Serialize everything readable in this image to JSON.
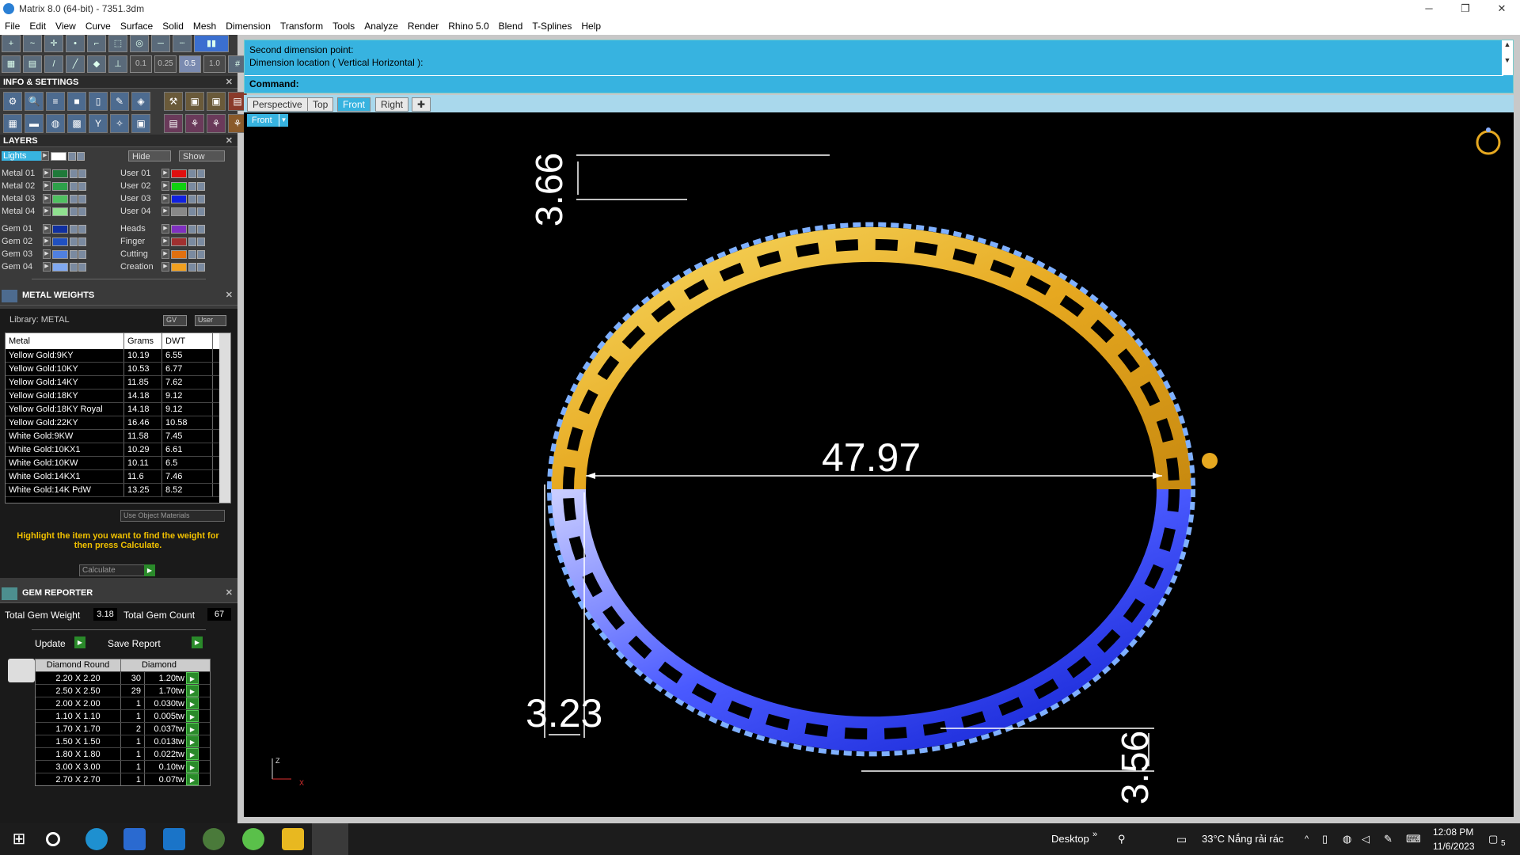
{
  "title": "Matrix 8.0 (64-bit) - 7351.3dm",
  "window_controls": [
    "─",
    "❐",
    "✕"
  ],
  "menu": [
    "File",
    "Edit",
    "View",
    "Curve",
    "Surface",
    "Solid",
    "Mesh",
    "Dimension",
    "Transform",
    "Tools",
    "Analyze",
    "Render",
    "Rhino 5.0",
    "Blend",
    "T-Splines",
    "Help"
  ],
  "toolbar_values": [
    "0.1",
    "0.25",
    "0.5",
    "1.0"
  ],
  "info_settings": {
    "title": "INFO & SETTINGS"
  },
  "layers": {
    "title": "LAYERS",
    "lights": "Lights",
    "hide": "Hide",
    "show": "Show",
    "left": [
      {
        "name": "Metal 01",
        "color": "#1f7a3a"
      },
      {
        "name": "Metal 02",
        "color": "#2ea04a"
      },
      {
        "name": "Metal 03",
        "color": "#4fc060"
      },
      {
        "name": "Metal 04",
        "color": "#8fe08f"
      },
      {
        "name": "Gem 01",
        "color": "#1030a0"
      },
      {
        "name": "Gem 02",
        "color": "#2050c0"
      },
      {
        "name": "Gem 03",
        "color": "#5080e0"
      },
      {
        "name": "Gem 04",
        "color": "#80a8f0"
      }
    ],
    "right": [
      {
        "name": "User 01",
        "color": "#e01010"
      },
      {
        "name": "User 02",
        "color": "#10d010"
      },
      {
        "name": "User 03",
        "color": "#1020e0"
      },
      {
        "name": "User 04",
        "color": "#888888"
      },
      {
        "name": "Heads",
        "color": "#8030c0"
      },
      {
        "name": "Finger",
        "color": "#a03030"
      },
      {
        "name": "Cutting",
        "color": "#e07010"
      },
      {
        "name": "Creation",
        "color": "#f0a020"
      }
    ]
  },
  "metal_weights": {
    "title": "METAL WEIGHTS",
    "library": "Library: METAL",
    "gv": "GV",
    "user": "User",
    "columns": [
      "Metal",
      "Grams",
      "DWT"
    ],
    "rows": [
      [
        "Yellow Gold:9KY",
        "10.19",
        "6.55"
      ],
      [
        "Yellow Gold:10KY",
        "10.53",
        "6.77"
      ],
      [
        "Yellow Gold:14KY",
        "11.85",
        "7.62"
      ],
      [
        "Yellow Gold:18KY",
        "14.18",
        "9.12"
      ],
      [
        "Yellow Gold:18KY Royal",
        "14.18",
        "9.12"
      ],
      [
        "Yellow Gold:22KY",
        "16.46",
        "10.58"
      ],
      [
        "White Gold:9KW",
        "11.58",
        "7.45"
      ],
      [
        "White Gold:10KX1",
        "10.29",
        "6.61"
      ],
      [
        "White Gold:10KW",
        "10.11",
        "6.5"
      ],
      [
        "White Gold:14KX1",
        "11.6",
        "7.46"
      ],
      [
        "White Gold:14K PdW",
        "13.25",
        "8.52"
      ]
    ],
    "use_object_materials": "Use Object Materials",
    "hint": "Highlight the item you want to find the weight for then press Calculate.",
    "calculate": "Calculate"
  },
  "gem_reporter": {
    "title": "GEM REPORTER",
    "total_weight_label": "Total Gem Weight",
    "total_weight": "3.18",
    "total_count_label": "Total Gem Count",
    "total_count": "67",
    "update": "Update",
    "save_report": "Save Report",
    "col_shape": "Diamond Round",
    "col_type": "Diamond",
    "rows": [
      [
        "2.20 X 2.20",
        "30",
        "1.20tw"
      ],
      [
        "2.50 X 2.50",
        "29",
        "1.70tw"
      ],
      [
        "2.00 X 2.00",
        "1",
        "0.030tw"
      ],
      [
        "1.10 X 1.10",
        "1",
        "0.005tw"
      ],
      [
        "1.70 X 1.70",
        "2",
        "0.037tw"
      ],
      [
        "1.50 X 1.50",
        "1",
        "0.013tw"
      ],
      [
        "1.80 X 1.80",
        "1",
        "0.022tw"
      ],
      [
        "3.00 X 3.00",
        "1",
        "0.10tw"
      ],
      [
        "2.70 X 2.70",
        "1",
        "0.07tw"
      ]
    ]
  },
  "command": {
    "line1": "Second dimension point:",
    "line2": "Dimension location ( Vertical  Horizontal ):",
    "prompt": "Command:"
  },
  "view_tabs": [
    "Perspective",
    "Top",
    "Front",
    "Right"
  ],
  "active_view": "Front",
  "viewport_label": "Front",
  "dimensions": {
    "top": "3.66",
    "width": "47.97",
    "bottom_left": "3.23",
    "bottom_right": "3.56"
  },
  "axis": {
    "z": "Z",
    "x": "X"
  },
  "colors": {
    "accent": "#37b3e0",
    "gold": "#e6a820",
    "blue": "#1a2ee0"
  },
  "taskbar": {
    "desktop": "Desktop",
    "weather": "33°C  Nắng rải rác",
    "time": "12:08 PM",
    "date": "11/6/2023",
    "notif": "5"
  }
}
